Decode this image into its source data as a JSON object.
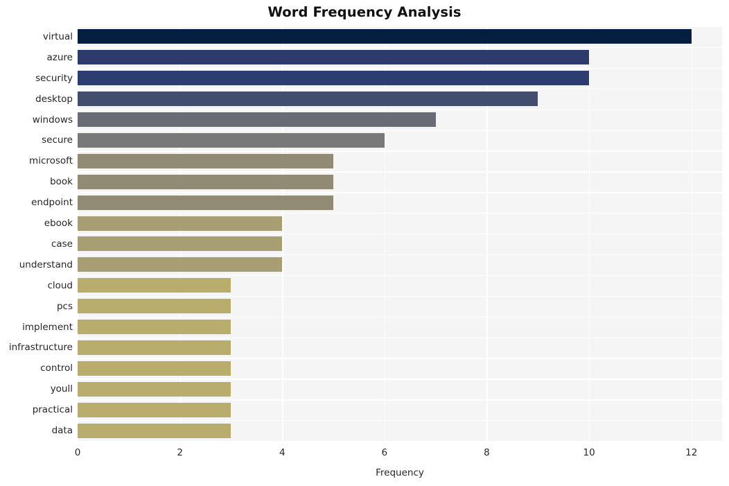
{
  "chart_data": {
    "type": "bar",
    "orientation": "horizontal",
    "title": "Word Frequency Analysis",
    "xlabel": "Frequency",
    "ylabel": "",
    "xlim": [
      0,
      12.6
    ],
    "ylim": [
      0,
      20
    ],
    "grid": true,
    "legend": null,
    "xticks": [
      0,
      2,
      4,
      6,
      8,
      10,
      12
    ],
    "xtick_labels": [
      "0",
      "2",
      "4",
      "6",
      "8",
      "10",
      "12"
    ],
    "categories": [
      "virtual",
      "azure",
      "security",
      "desktop",
      "windows",
      "secure",
      "microsoft",
      "book",
      "endpoint",
      "ebook",
      "case",
      "understand",
      "cloud",
      "pcs",
      "implement",
      "infrastructure",
      "control",
      "youll",
      "practical",
      "data"
    ],
    "values": [
      12,
      10,
      10,
      9,
      7,
      6,
      5,
      5,
      5,
      4,
      4,
      4,
      3,
      3,
      3,
      3,
      3,
      3,
      3,
      3
    ],
    "bar_colors": [
      "#041e42",
      "#2c3b6b",
      "#2c3d71",
      "#434e6f",
      "#696c74",
      "#79797a",
      "#918b76",
      "#918b76",
      "#918b76",
      "#a89e73",
      "#a89e73",
      "#a89e73",
      "#b9ad6e",
      "#b9ad6e",
      "#b9ad6e",
      "#b9ad6e",
      "#b9ad6e",
      "#b9ad6e",
      "#b9ad6e",
      "#b9ad6e"
    ]
  },
  "style": {
    "figure_background": "#ffffff",
    "plot_background": "#f5f5f6",
    "grid_color": "#ffffff",
    "text_color": "#262626",
    "title_color": "#111111"
  }
}
